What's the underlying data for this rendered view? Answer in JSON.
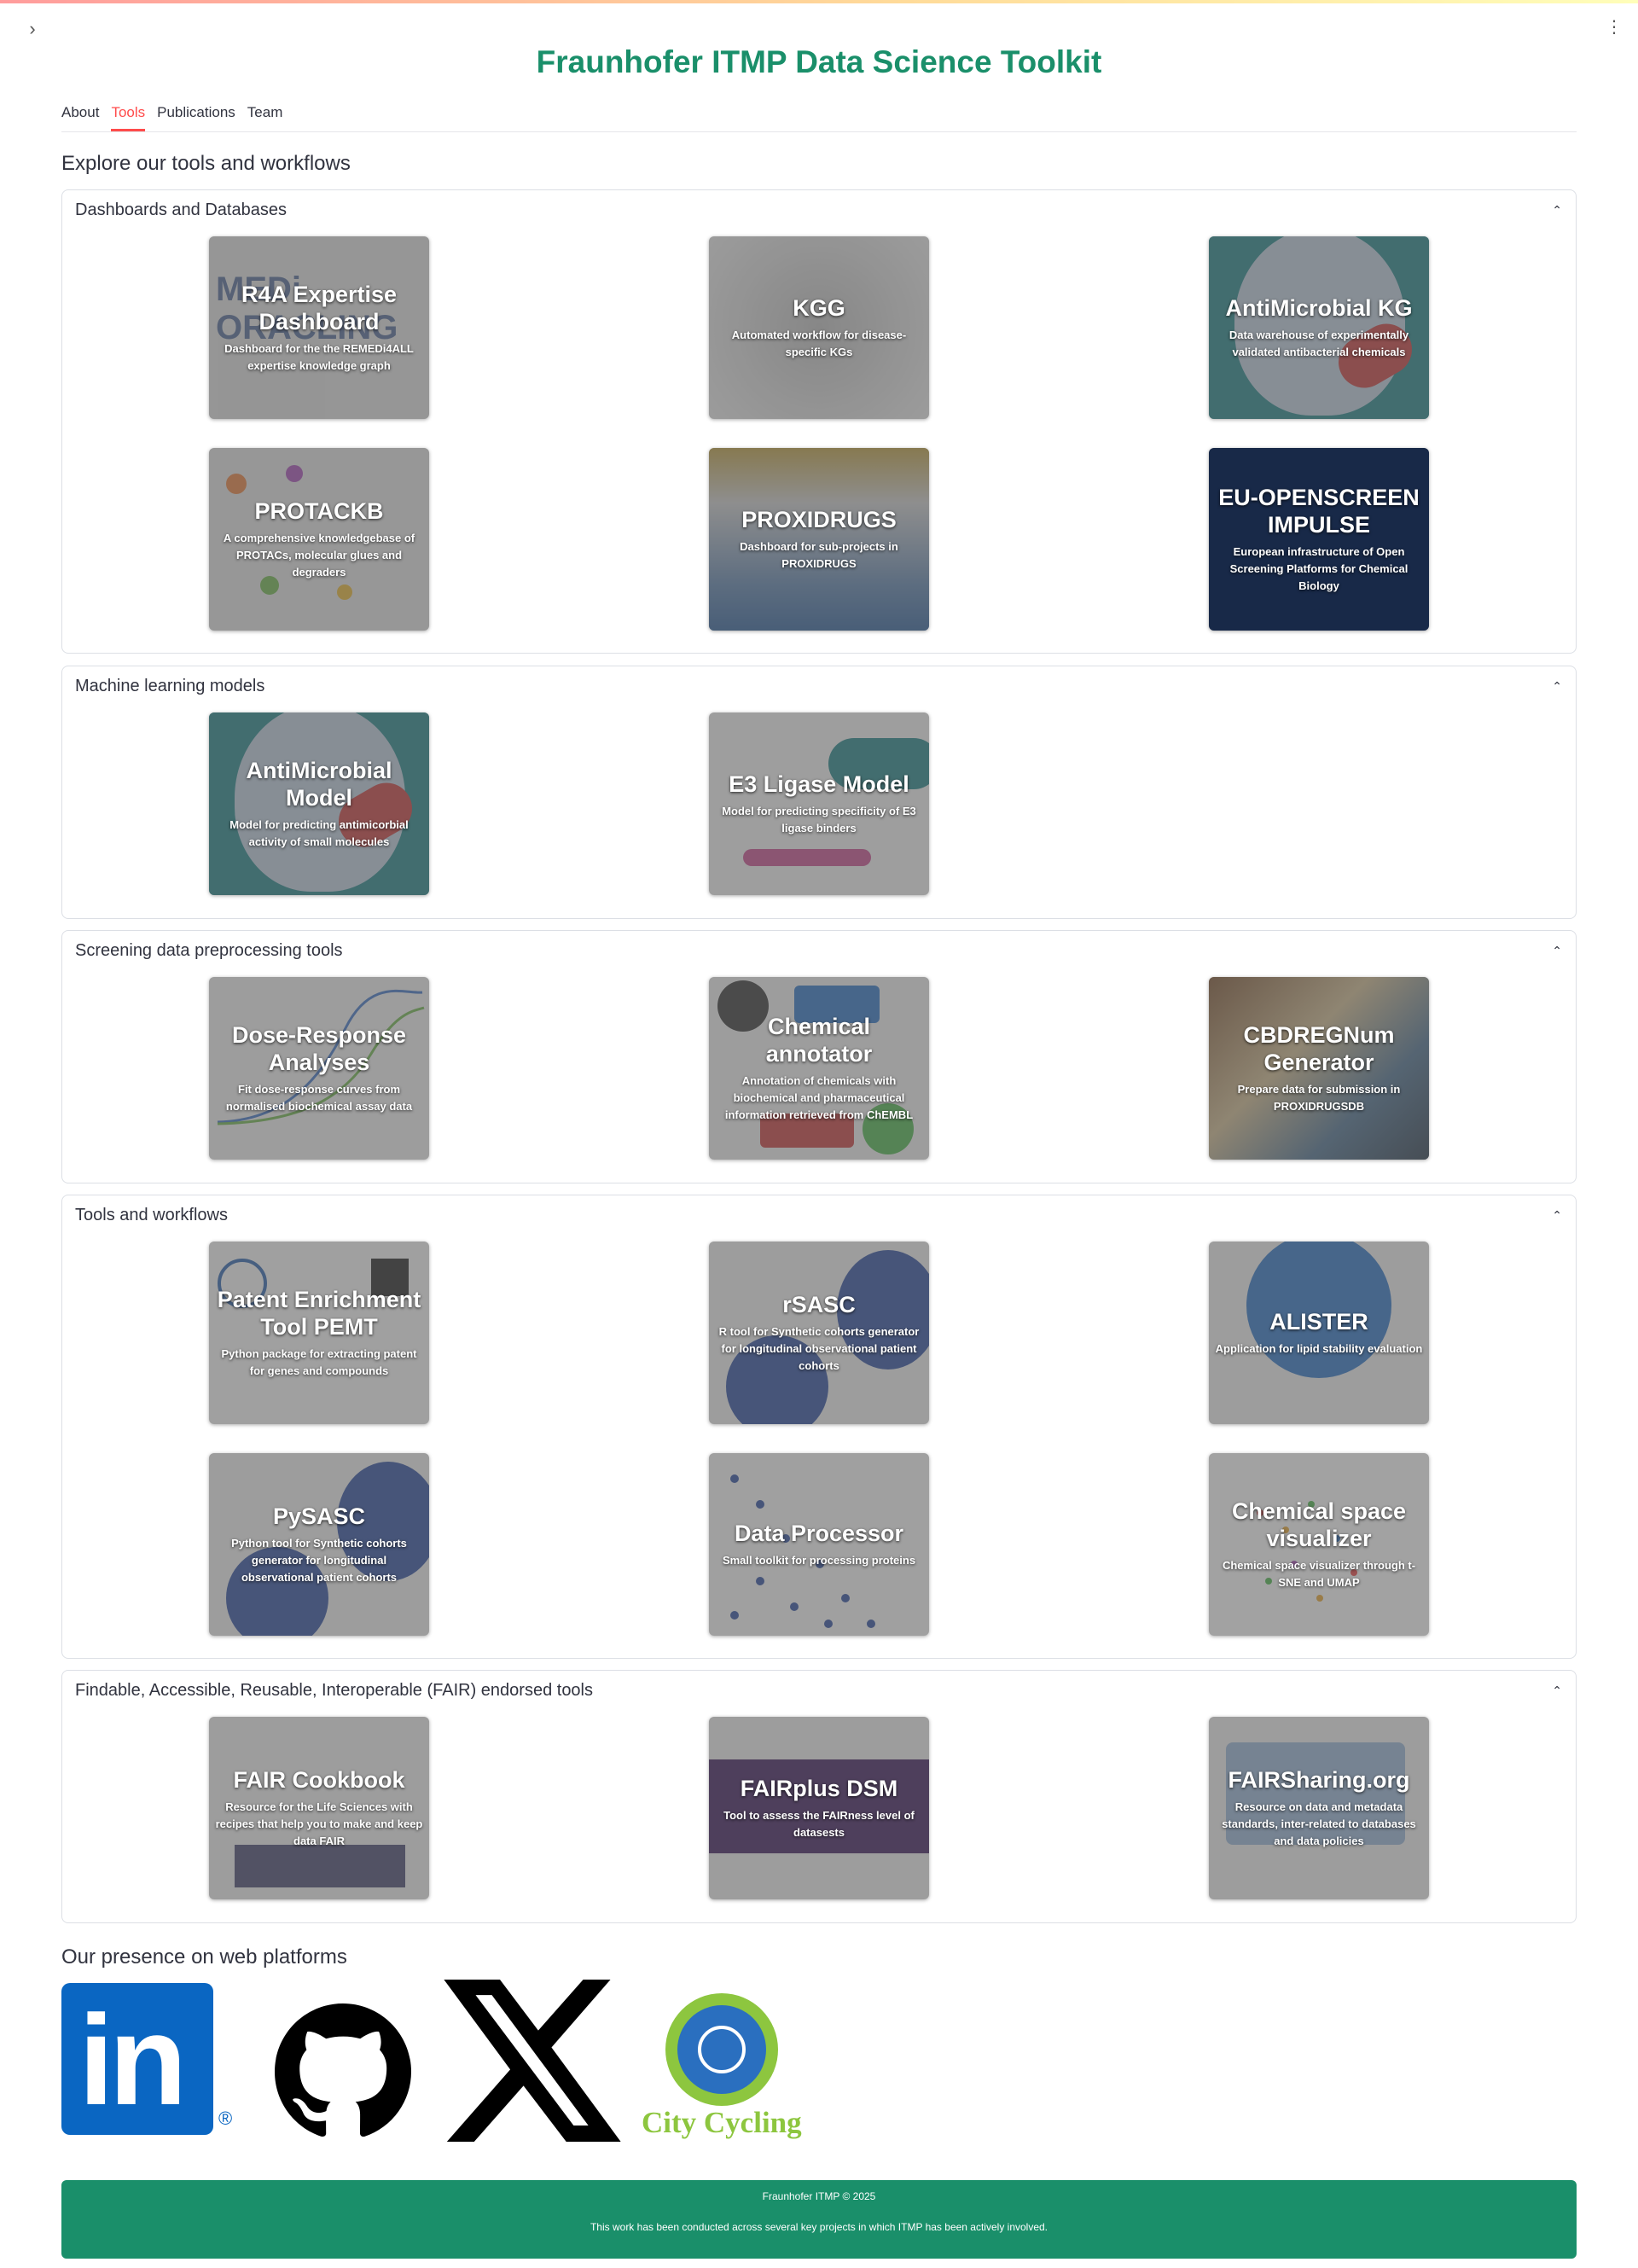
{
  "app": {
    "title": "Fraunhofer ITMP Data Science Toolkit"
  },
  "tabs": [
    {
      "label": "About"
    },
    {
      "label": "Tools",
      "active": true
    },
    {
      "label": "Publications"
    },
    {
      "label": "Team"
    }
  ],
  "heading_tools": "Explore our tools and workflows",
  "sections": [
    {
      "title": "Dashboards and Databases",
      "cards": [
        {
          "title": "R4A Expertise Dashboard",
          "desc": "Dashboard for the the REMEDi4ALL expertise knowledge graph"
        },
        {
          "title": "KGG",
          "desc": "Automated workflow for disease-specific KGs"
        },
        {
          "title": "AntiMicrobial KG",
          "desc": "Data warehouse of experimentally validated antibacterial chemicals"
        },
        {
          "title": "PROTACKB",
          "desc": "A comprehensive knowledgebase of PROTACs, molecular glues and degraders"
        },
        {
          "title": "PROXIDRUGS",
          "desc": "Dashboard for sub-projects in PROXIDRUGS"
        },
        {
          "title": "EU-OPENSCREEN IMPULSE",
          "desc": "European infrastructure of Open Screening Platforms for Chemical Biology"
        }
      ]
    },
    {
      "title": "Machine learning models",
      "cards": [
        {
          "title": "AntiMicrobial Model",
          "desc": "Model for predicting antimicorbial activity of small molecules"
        },
        {
          "title": "E3 Ligase Model",
          "desc": "Model for predicting specificity of E3 ligase binders"
        }
      ]
    },
    {
      "title": "Screening data preprocessing tools",
      "cards": [
        {
          "title": "Dose-Response Analyses",
          "desc": "Fit dose-response curves from normalised biochemical assay data"
        },
        {
          "title": "Chemical annotator",
          "desc": "Annotation of chemicals with biochemical and pharmaceutical information retrieved from ChEMBL"
        },
        {
          "title": "CBDREGNum Generator",
          "desc": "Prepare data for submission in PROXIDRUGSDB"
        }
      ]
    },
    {
      "title": "Tools and workflows",
      "cards": [
        {
          "title": "Patent Enrichment Tool PEMT",
          "desc": "Python package for extracting patent for genes and compounds"
        },
        {
          "title": "rSASC",
          "desc": "R tool for Synthetic cohorts generator for longitudinal observational patient cohorts"
        },
        {
          "title": "ALISTER",
          "desc": "Application for lipid stability evaluation"
        },
        {
          "title": "PySASC",
          "desc": "Python tool for Synthetic cohorts generator for longitudinal observational patient cohorts"
        },
        {
          "title": "Data Processor",
          "desc": "Small toolkit for processing proteins"
        },
        {
          "title": "Chemical space visualizer",
          "desc": "Chemical space visualizer through t-SNE and UMAP"
        }
      ]
    },
    {
      "title": "Findable, Accessible, Reusable, Interoperable (FAIR) endorsed tools",
      "cards": [
        {
          "title": "FAIR Cookbook",
          "desc": "Resource for the Life Sciences with recipes that help you to make and keep data FAIR"
        },
        {
          "title": "FAIRplus DSM",
          "desc": "Tool to assess the FAIRness level of datasests"
        },
        {
          "title": "FAIRSharing.org",
          "desc": "Resource on data and metadata standards, inter-related to databases and data policies"
        }
      ]
    }
  ],
  "heading_web": "Our presence on web platforms",
  "social": {
    "linkedin": "in",
    "city_cycling": "City Cycling"
  },
  "footer": {
    "copyright": "Fraunhofer ITMP © 2025",
    "note": "This work has been conducted across several key projects in which ITMP has been actively involved."
  },
  "icons": [
    "chevron-right-icon",
    "more-vertical-icon",
    "chevron-up-icon",
    "linkedin-icon",
    "github-icon",
    "x-icon",
    "city-cycling-icon"
  ],
  "colors": {
    "accent": "#1a8f6a",
    "tab_active": "#ff4b4b",
    "linkedin": "#0a66c2",
    "city_cycling_green": "#8dc63f"
  }
}
